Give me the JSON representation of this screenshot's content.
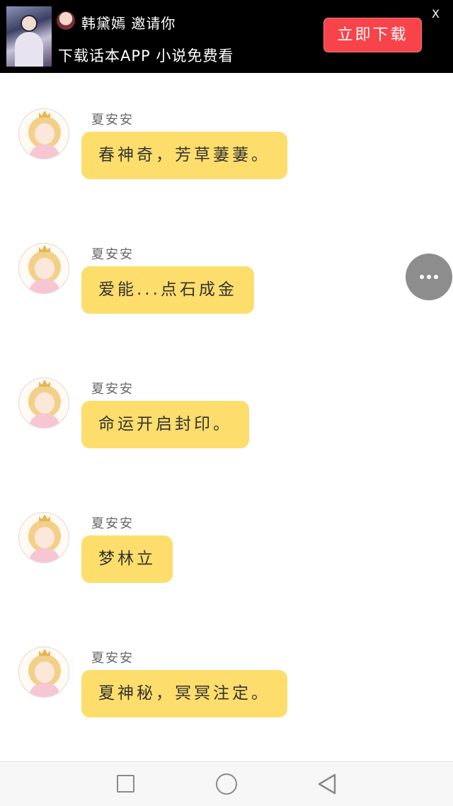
{
  "banner": {
    "inviter": "韩黛嫣 邀请你",
    "tagline": "下载话本APP 小说免费看",
    "download_label": "立即下载",
    "close_label": "X"
  },
  "chat": {
    "messages": [
      {
        "sender": "夏安安",
        "text": "春神奇，芳草萋萋。"
      },
      {
        "sender": "夏安安",
        "text": "爱能...点石成金"
      },
      {
        "sender": "夏安安",
        "text": "命运开启封印。"
      },
      {
        "sender": "夏安安",
        "text": "梦林立"
      },
      {
        "sender": "夏安安",
        "text": "夏神秘，冥冥注定。"
      }
    ]
  },
  "colors": {
    "bubble": "#fdde6c",
    "download_button": "#f8434a",
    "banner_background": "#000000"
  },
  "icons": {
    "more": "more-horizontal-icon",
    "nav_recent": "square-icon",
    "nav_home": "circle-icon",
    "nav_back": "triangle-back-icon"
  }
}
